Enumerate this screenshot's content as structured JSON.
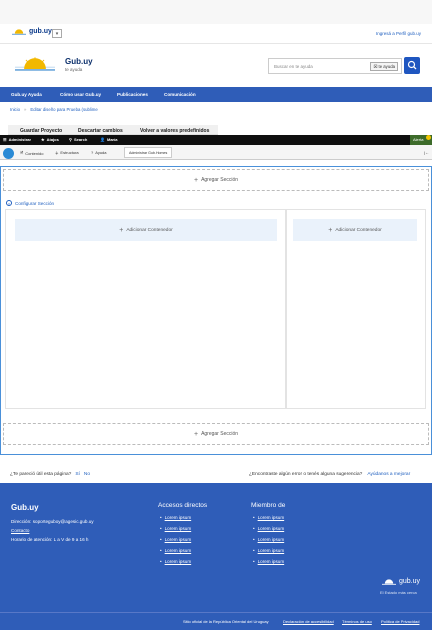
{
  "topbar": {
    "logo_text": "gub.uy",
    "dropdown_icon": "chevron-down-icon",
    "login_link": "Ingresá a Perfil gub.uy"
  },
  "header": {
    "title": "Gub.uy",
    "subtitle": "te ayuda",
    "search_placeholder": "Buscar en te ayuda",
    "search_scope": "te ayuda",
    "search_icon": "search-icon"
  },
  "nav": {
    "items": [
      "Gub.uy Ayuda",
      "Cómo usar Gub.uy",
      "Publicaciones",
      "Comunicación"
    ]
  },
  "breadcrumb": {
    "home": "Inicio",
    "current": "Editar diseño para Prueba (sublime"
  },
  "local_tabs": [
    "Guardar Proyecto",
    "Descartar cambios",
    "Volver a valores predefinidos"
  ],
  "admin_toolbar": {
    "items": [
      "Administrar",
      "Atajos",
      "Search",
      "María"
    ],
    "alert": "Alerta",
    "secondary": [
      "Contenido",
      "Estructura",
      "Ayuda"
    ],
    "tab_label": "Administrar Gub.Homes"
  },
  "layout_builder": {
    "add_section": "Agregar Sección",
    "configure_section": "Configurar Sección",
    "add_block": "Adicionar Contenedor"
  },
  "feedback": {
    "question": "¿Te pareció útil esta página?",
    "yes": "Sí",
    "no": "No",
    "suggestion": "¿Encontraste algún error o tenés alguna sugerencia?",
    "improve_link": "Ayúdanos a mejorar"
  },
  "footer": {
    "title": "Gub.uy",
    "direction_label": "Dirección:",
    "email": "soporteguboy@agesic.gub.uy",
    "contact": "Contacto",
    "hours": "Horario de atención: L a V de 9 a 16 h",
    "col1_title": "Accesos directos",
    "col1_links": [
      "Lorem ipsum",
      "Lorem ipsum",
      "Lorem ipsum",
      "Lorem ipsum",
      "Lorem ipsum"
    ],
    "col2_title": "Miembro de",
    "col2_links": [
      "Lorem ipsum",
      "Lorem ipsum",
      "Lorem ipsum",
      "Lorem ipsum",
      "Lorem ipsum"
    ],
    "logo_text": "gub.uy",
    "logo_sub": "El Estado más cerca",
    "bottom": [
      "Sitio oficial de la República Oriental del Uruguay",
      "Declaración de accesibilidad",
      "Términos de uso",
      "Política de Privacidad"
    ]
  },
  "colors": {
    "primary": "#2f5db8",
    "link": "#1f5fbf",
    "admin_bar": "#0f0f0f",
    "canvas_border": "#4a90d9"
  }
}
